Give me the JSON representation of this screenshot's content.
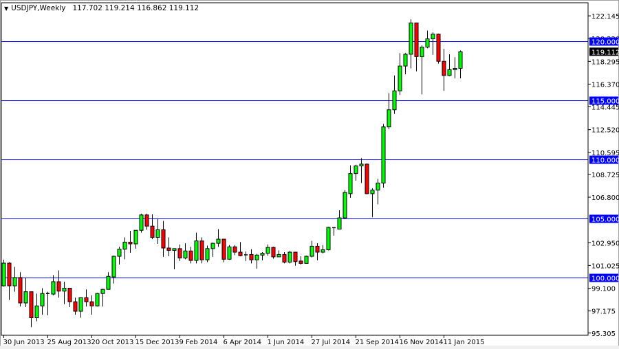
{
  "header": {
    "symbol_timeframe": "USDJPY,Weekly",
    "ohlc_text": "117.702 119.214 116.862 119.112",
    "menu_icon": "triangle-down-icon"
  },
  "colors": {
    "bull": "#00ff00",
    "bear": "#ff0000",
    "outline": "#000000",
    "level_line": "#0000ff",
    "level_label_bg": "#0000ff",
    "price_label_bg": "#000000"
  },
  "chart_data": {
    "type": "candlestick",
    "title": "USDJPY,Weekly",
    "ylim": [
      95.305,
      122.145
    ],
    "y_ticks": [
      "122.145",
      "120.220",
      "118.295",
      "116.370",
      "114.445",
      "112.520",
      "110.595",
      "108.725",
      "106.800",
      "102.950",
      "101.025",
      "99.100",
      "97.175",
      "95.305"
    ],
    "x_ticks": [
      {
        "label": "30 Jun 2013",
        "week": 0
      },
      {
        "label": "25 Aug 2013",
        "week": 8
      },
      {
        "label": "20 Oct 2013",
        "week": 16
      },
      {
        "label": "15 Dec 2013",
        "week": 24
      },
      {
        "label": "9 Feb 2014",
        "week": 32
      },
      {
        "label": "6 Apr 2014",
        "week": 40
      },
      {
        "label": "1 Jun 2014",
        "week": 48
      },
      {
        "label": "27 Jul 2014",
        "week": 56
      },
      {
        "label": "21 Sep 2014",
        "week": 64
      },
      {
        "label": "16 Nov 2014",
        "week": 72
      },
      {
        "label": "11 Jan 2015",
        "week": 80
      }
    ],
    "levels": [
      {
        "price": 120.0,
        "label": "120.000"
      },
      {
        "price": 115.0,
        "label": "115.000"
      },
      {
        "price": 110.0,
        "label": "110.000"
      },
      {
        "price": 105.0,
        "label": "105.000"
      },
      {
        "price": 100.0,
        "label": "100.000"
      }
    ],
    "current_price": {
      "price": 119.112,
      "label": "119.112"
    },
    "ohlc_fields": [
      "open",
      "high",
      "low",
      "close"
    ],
    "candles": [
      [
        99.3,
        101.51,
        99.24,
        101.22
      ],
      [
        101.22,
        101.3,
        98.1,
        99.3
      ],
      [
        99.3,
        100.9,
        98.8,
        100.0
      ],
      [
        100.0,
        100.45,
        97.55,
        97.85
      ],
      [
        97.85,
        100.0,
        97.5,
        98.8
      ],
      [
        98.8,
        98.8,
        95.8,
        96.6
      ],
      [
        96.6,
        98.65,
        96.3,
        97.6
      ],
      [
        97.6,
        99.1,
        96.85,
        98.65
      ],
      [
        98.6,
        98.8,
        96.8,
        98.65
      ],
      [
        98.6,
        100.2,
        98.5,
        99.65
      ],
      [
        99.65,
        100.6,
        98.3,
        98.85
      ],
      [
        98.85,
        99.65,
        97.75,
        99.1
      ],
      [
        99.1,
        99.1,
        97.5,
        97.95
      ],
      [
        97.95,
        98.3,
        96.85,
        97.15
      ],
      [
        97.15,
        98.3,
        96.6,
        98.3
      ],
      [
        98.3,
        99.0,
        97.55,
        97.95
      ],
      [
        97.95,
        98.5,
        96.85,
        97.6
      ],
      [
        97.6,
        98.7,
        97.55,
        98.65
      ],
      [
        98.65,
        99.05,
        97.55,
        99.0
      ],
      [
        99.0,
        100.45,
        99.0,
        100.1
      ],
      [
        100.05,
        101.85,
        99.5,
        101.8
      ],
      [
        101.8,
        102.6,
        101.1,
        102.4
      ],
      [
        102.4,
        103.4,
        101.55,
        103.0
      ],
      [
        103.0,
        103.95,
        102.1,
        102.85
      ],
      [
        102.85,
        104.0,
        102.45,
        104.0
      ],
      [
        104.0,
        105.4,
        103.8,
        105.3
      ],
      [
        105.3,
        105.4,
        104.05,
        104.35
      ],
      [
        104.35,
        105.35,
        103.25,
        103.4
      ],
      [
        103.4,
        104.95,
        102.85,
        104.05
      ],
      [
        104.05,
        104.8,
        101.75,
        102.5
      ],
      [
        102.5,
        103.4,
        101.8,
        102.3
      ],
      [
        102.3,
        102.45,
        100.7,
        102.45
      ],
      [
        102.45,
        102.8,
        101.4,
        101.65
      ],
      [
        101.65,
        102.9,
        101.55,
        102.25
      ],
      [
        102.25,
        102.6,
        101.2,
        101.45
      ],
      [
        101.45,
        103.8,
        101.2,
        103.1
      ],
      [
        103.1,
        103.4,
        101.2,
        101.5
      ],
      [
        101.5,
        102.7,
        101.3,
        102.45
      ],
      [
        102.45,
        102.95,
        101.75,
        102.9
      ],
      [
        102.9,
        104.1,
        102.6,
        103.25
      ],
      [
        103.25,
        103.25,
        101.3,
        101.55
      ],
      [
        101.55,
        102.75,
        101.5,
        102.6
      ],
      [
        102.6,
        102.75,
        101.9,
        102.15
      ],
      [
        102.15,
        103.0,
        101.8,
        101.85
      ],
      [
        101.9,
        102.2,
        101.4,
        101.92
      ],
      [
        101.95,
        102.4,
        101.2,
        101.5
      ],
      [
        101.5,
        102.0,
        100.75,
        101.9
      ],
      [
        101.9,
        102.15,
        101.45,
        102.05
      ],
      [
        102.05,
        102.8,
        101.85,
        102.55
      ],
      [
        102.55,
        102.6,
        101.6,
        101.75
      ],
      [
        101.75,
        102.3,
        101.75,
        101.95
      ],
      [
        101.95,
        102.15,
        101.2,
        101.3
      ],
      [
        101.3,
        102.25,
        101.2,
        102.15
      ],
      [
        102.15,
        102.15,
        101.0,
        101.35
      ],
      [
        101.4,
        101.8,
        101.1,
        101.2
      ],
      [
        101.2,
        101.85,
        101.2,
        101.8
      ],
      [
        101.8,
        103.1,
        101.7,
        102.65
      ],
      [
        102.65,
        102.9,
        101.45,
        102.15
      ],
      [
        102.15,
        102.75,
        102.05,
        102.35
      ],
      [
        102.35,
        104.3,
        102.3,
        104.25
      ],
      [
        104.2,
        104.25,
        103.55,
        104.22
      ],
      [
        104.1,
        105.7,
        104.1,
        105.05
      ],
      [
        105.05,
        107.4,
        105.0,
        107.2
      ],
      [
        107.1,
        109.5,
        106.75,
        108.8
      ],
      [
        108.8,
        109.55,
        108.2,
        109.45
      ],
      [
        109.45,
        110.1,
        108.0,
        109.6
      ],
      [
        109.6,
        109.65,
        107.05,
        107.1
      ],
      [
        107.1,
        107.55,
        105.1,
        107.4
      ],
      [
        107.4,
        108.35,
        106.2,
        108.0
      ],
      [
        108.0,
        113.0,
        107.6,
        112.75
      ],
      [
        112.75,
        115.6,
        112.55,
        114.2
      ],
      [
        114.2,
        117.1,
        113.85,
        115.8
      ],
      [
        115.8,
        119.0,
        115.45,
        117.9
      ],
      [
        117.9,
        119.0,
        117.2,
        118.9
      ],
      [
        118.9,
        121.85,
        117.7,
        121.55
      ],
      [
        121.55,
        121.55,
        117.45,
        118.7
      ],
      [
        118.7,
        119.65,
        115.5,
        119.5
      ],
      [
        119.5,
        120.9,
        119.4,
        120.2
      ],
      [
        120.2,
        120.75,
        118.85,
        120.6
      ],
      [
        120.6,
        120.65,
        118.1,
        118.3
      ],
      [
        118.3,
        119.35,
        115.8,
        117.1
      ],
      [
        117.1,
        118.9,
        117.05,
        117.6
      ],
      [
        117.6,
        118.65,
        116.85,
        117.702
      ],
      [
        117.702,
        119.214,
        116.862,
        119.112
      ]
    ]
  }
}
